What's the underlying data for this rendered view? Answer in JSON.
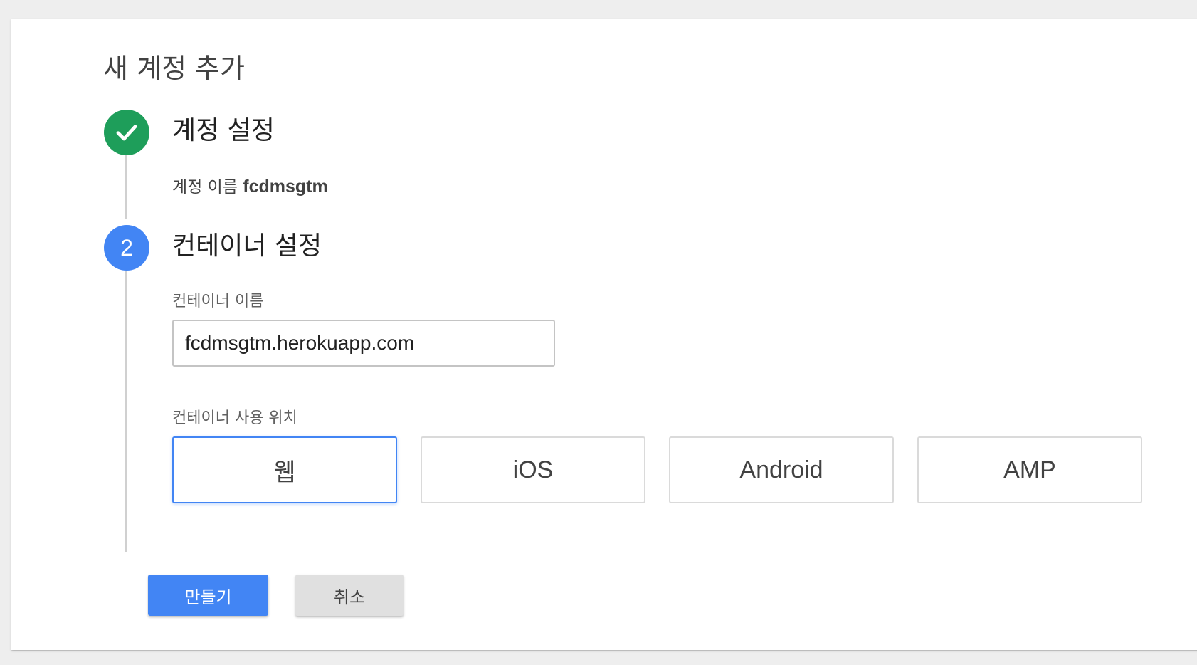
{
  "page": {
    "title": "새 계정 추가"
  },
  "steps": [
    {
      "status": "complete",
      "icon": "check-icon",
      "title": "계정 설정",
      "account_name_label": "계정 이름",
      "account_name_value": "fcdmsgtm"
    },
    {
      "status": "active",
      "number": "2",
      "title": "컨테이너 설정"
    }
  ],
  "container": {
    "name_label": "컨테이너 이름",
    "name_value": "fcdmsgtm.herokuapp.com",
    "usage_label": "컨테이너 사용 위치",
    "platforms": [
      {
        "label": "웹",
        "selected": true
      },
      {
        "label": "iOS",
        "selected": false
      },
      {
        "label": "Android",
        "selected": false
      },
      {
        "label": "AMP",
        "selected": false
      }
    ]
  },
  "actions": {
    "create_label": "만들기",
    "cancel_label": "취소"
  },
  "colors": {
    "complete": "#1e9e5a",
    "active": "#4285f4",
    "primary_button": "#4285f4",
    "secondary_button": "#e0e0e0"
  }
}
